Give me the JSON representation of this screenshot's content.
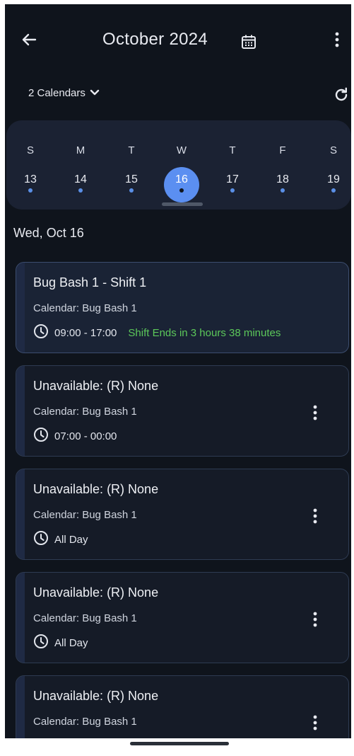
{
  "header": {
    "title": "October 2024"
  },
  "selector": {
    "label": "2 Calendars"
  },
  "week": {
    "days": [
      {
        "dow": "S",
        "num": "13"
      },
      {
        "dow": "M",
        "num": "14"
      },
      {
        "dow": "T",
        "num": "15"
      },
      {
        "dow": "W",
        "num": "16"
      },
      {
        "dow": "T",
        "num": "17"
      },
      {
        "dow": "F",
        "num": "18"
      },
      {
        "dow": "S",
        "num": "19"
      }
    ],
    "selected_num": "16"
  },
  "date_heading": "Wed, Oct 16",
  "events": [
    {
      "title": "Bug Bash 1 - Shift 1",
      "calendar": "Calendar: Bug Bash 1",
      "time": "09:00 - 17:00",
      "status": "Shift Ends in 3 hours 38 minutes"
    },
    {
      "title": "Unavailable: (R) None",
      "calendar": "Calendar: Bug Bash 1",
      "time": "07:00 - 00:00"
    },
    {
      "title": "Unavailable: (R) None",
      "calendar": "Calendar: Bug Bash 1",
      "time": "All Day"
    },
    {
      "title": "Unavailable: (R) None",
      "calendar": "Calendar: Bug Bash 1",
      "time": "All Day"
    },
    {
      "title": "Unavailable: (R) None",
      "calendar": "Calendar: Bug Bash 1"
    }
  ],
  "colors": {
    "background": "#0f141c",
    "accent": "#5b8ff1",
    "status_green": "#5cc85a",
    "event_dot": "#5a8fe6"
  },
  "icons": [
    "back-arrow-icon",
    "calendar-icon",
    "more-vert-icon",
    "chevron-down-icon",
    "refresh-icon",
    "clock-icon"
  ]
}
